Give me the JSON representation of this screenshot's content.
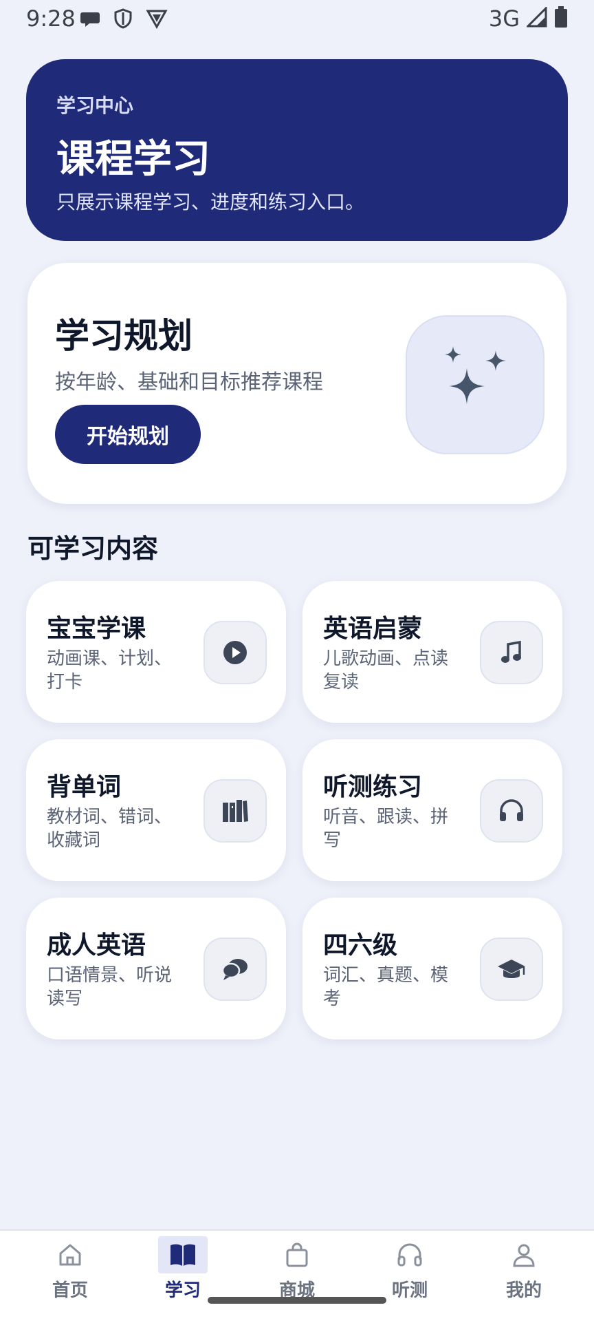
{
  "status_bar": {
    "time": "9:28",
    "network": "3G"
  },
  "hero": {
    "kicker": "学习中心",
    "title": "课程学习",
    "subtitle": "只展示课程学习、进度和练习入口。",
    "color": "#1f2a78"
  },
  "plan": {
    "title": "学习规划",
    "subtitle": "按年龄、基础和目标推荐课程",
    "button_label": "开始规划",
    "icon": "sparkles-icon"
  },
  "section_title": "可学习内容",
  "tiles": [
    {
      "title": "宝宝学课",
      "desc": "动画课、计划、打卡",
      "icon": "play-circle-icon"
    },
    {
      "title": "英语启蒙",
      "desc": "儿歌动画、点读复读",
      "icon": "music-note-icon"
    },
    {
      "title": "背单词",
      "desc": "教材词、错词、收藏词",
      "icon": "books-icon"
    },
    {
      "title": "听测练习",
      "desc": "听音、跟读、拼写",
      "icon": "headphones-icon"
    },
    {
      "title": "成人英语",
      "desc": "口语情景、听说读写",
      "icon": "chat-bubbles-icon"
    },
    {
      "title": "四六级",
      "desc": "词汇、真题、模考",
      "icon": "graduation-cap-icon"
    }
  ],
  "nav": {
    "items": [
      {
        "label": "首页",
        "icon": "home-icon"
      },
      {
        "label": "学习",
        "icon": "book-icon",
        "active": true
      },
      {
        "label": "商城",
        "icon": "shopping-bag-icon"
      },
      {
        "label": "听测",
        "icon": "headphones-icon"
      },
      {
        "label": "我的",
        "icon": "user-icon"
      }
    ]
  }
}
